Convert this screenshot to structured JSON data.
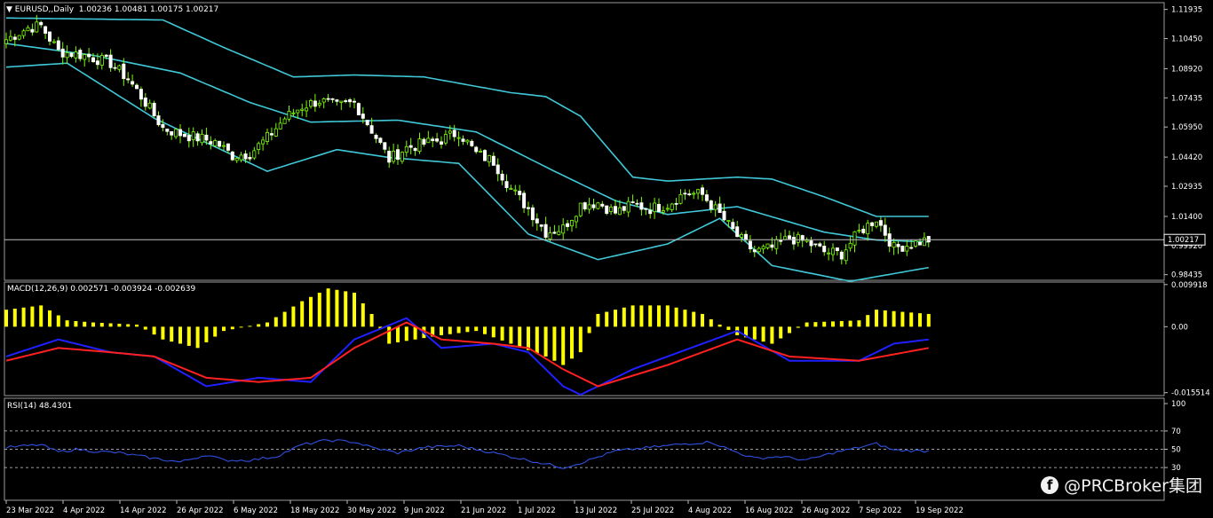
{
  "chart_data": [
    {
      "type": "candlestick",
      "title": "EURUSD,,Daily",
      "ohlc_readout": "1.00236 1.00481 1.00175 1.00217",
      "current_price_label": "1.00217",
      "current_price": 1.00217,
      "ylim": [
        0.9815,
        1.1228
      ],
      "y_ticks": [
        "1.11935",
        "1.10450",
        "1.08920",
        "1.07435",
        "1.05950",
        "1.04420",
        "1.02935",
        "1.01400",
        "0.99920",
        "0.98435"
      ],
      "x_tick_labels": [
        "23 Mar 2022",
        "4 Apr 2022",
        "14 Apr 2022",
        "26 Apr 2022",
        "6 May 2022",
        "18 May 2022",
        "30 May 2022",
        "9 Jun 2022",
        "21 Jun 2022",
        "1 Jul 2022",
        "13 Jul 2022",
        "25 Jul 2022",
        "4 Aug 2022",
        "16 Aug 2022",
        "26 Aug 2022",
        "7 Sep 2022",
        "19 Sep 2022"
      ],
      "close_trend": [
        [
          0,
          1.104
        ],
        [
          5,
          1.11
        ],
        [
          8,
          1.111
        ],
        [
          12,
          1.098
        ],
        [
          18,
          1.096
        ],
        [
          24,
          1.092
        ],
        [
          28,
          1.084
        ],
        [
          32,
          1.072
        ],
        [
          36,
          1.059
        ],
        [
          40,
          1.056
        ],
        [
          44,
          1.054
        ],
        [
          48,
          1.052
        ],
        [
          52,
          1.045
        ],
        [
          56,
          1.046
        ],
        [
          60,
          1.054
        ],
        [
          64,
          1.064
        ],
        [
          68,
          1.07
        ],
        [
          72,
          1.073
        ],
        [
          76,
          1.07
        ],
        [
          80,
          1.072
        ],
        [
          84,
          1.058
        ],
        [
          88,
          1.043
        ],
        [
          92,
          1.049
        ],
        [
          96,
          1.051
        ],
        [
          100,
          1.053
        ],
        [
          104,
          1.057
        ],
        [
          108,
          1.046
        ],
        [
          112,
          1.042
        ],
        [
          116,
          1.028
        ],
        [
          120,
          1.018
        ],
        [
          124,
          1.006
        ],
        [
          128,
          1.008
        ],
        [
          132,
          1.02
        ],
        [
          136,
          1.021
        ],
        [
          140,
          1.016
        ],
        [
          144,
          1.02
        ],
        [
          148,
          1.018
        ],
        [
          152,
          1.02
        ],
        [
          156,
          1.026
        ],
        [
          160,
          1.025
        ],
        [
          164,
          1.015
        ],
        [
          168,
          1.004
        ],
        [
          172,
          0.996
        ],
        [
          176,
          0.998
        ],
        [
          180,
          1.003
        ],
        [
          184,
          1.001
        ],
        [
          188,
          0.996
        ],
        [
          192,
          0.995
        ],
        [
          196,
          1.006
        ],
        [
          200,
          1.013
        ],
        [
          204,
          0.998
        ],
        [
          208,
          1.0
        ],
        [
          212,
          1.0022
        ]
      ],
      "bollinger_bands": {
        "upper": [
          [
            0,
            1.115
          ],
          [
            36,
            1.114
          ],
          [
            50,
            1.1
          ],
          [
            66,
            1.085
          ],
          [
            80,
            1.086
          ],
          [
            96,
            1.085
          ],
          [
            116,
            1.077
          ],
          [
            124,
            1.075
          ],
          [
            132,
            1.065
          ],
          [
            144,
            1.034
          ],
          [
            152,
            1.032
          ],
          [
            168,
            1.034
          ],
          [
            176,
            1.033
          ],
          [
            188,
            1.024
          ],
          [
            200,
            1.014
          ],
          [
            212,
            1.014
          ]
        ],
        "middle": [
          [
            0,
            1.102
          ],
          [
            20,
            1.096
          ],
          [
            40,
            1.087
          ],
          [
            56,
            1.072
          ],
          [
            70,
            1.062
          ],
          [
            90,
            1.063
          ],
          [
            108,
            1.057
          ],
          [
            126,
            1.037
          ],
          [
            140,
            1.022
          ],
          [
            152,
            1.015
          ],
          [
            168,
            1.019
          ],
          [
            188,
            1.006
          ],
          [
            200,
            1.002
          ],
          [
            212,
            1.001
          ]
        ],
        "lower": [
          [
            0,
            1.09
          ],
          [
            14,
            1.092
          ],
          [
            34,
            1.064
          ],
          [
            60,
            1.037
          ],
          [
            76,
            1.048
          ],
          [
            88,
            1.044
          ],
          [
            104,
            1.041
          ],
          [
            120,
            1.005
          ],
          [
            136,
            0.992
          ],
          [
            152,
            1.0
          ],
          [
            164,
            1.013
          ],
          [
            176,
            0.989
          ],
          [
            194,
            0.981
          ],
          [
            212,
            0.988
          ]
        ]
      },
      "indicator_colors": {
        "bull": "#7CFC00",
        "bollinger": "#40C8D8"
      }
    },
    {
      "type": "bar",
      "title": "MACD(12,26,9) 0.002571 -0.003924 -0.002639",
      "ylim": [
        -0.0162,
        0.0105
      ],
      "y_ticks": [
        "0.009918",
        "0.00",
        "-0.015514"
      ],
      "histogram_trend": [
        [
          0,
          0.004
        ],
        [
          8,
          0.005
        ],
        [
          14,
          0.0015
        ],
        [
          20,
          0.001
        ],
        [
          30,
          0.0005
        ],
        [
          36,
          -0.003
        ],
        [
          44,
          -0.005
        ],
        [
          50,
          -0.001
        ],
        [
          60,
          0.001
        ],
        [
          68,
          0.006
        ],
        [
          74,
          0.009
        ],
        [
          80,
          0.008
        ],
        [
          84,
          0.003
        ],
        [
          88,
          -0.004
        ],
        [
          94,
          -0.003
        ],
        [
          100,
          -0.002
        ],
        [
          108,
          -0.001
        ],
        [
          116,
          -0.004
        ],
        [
          124,
          -0.007
        ],
        [
          128,
          -0.009
        ],
        [
          132,
          -0.006
        ],
        [
          136,
          0.003
        ],
        [
          144,
          0.005
        ],
        [
          152,
          0.005
        ],
        [
          160,
          0.003
        ],
        [
          168,
          -0.002
        ],
        [
          176,
          -0.004
        ],
        [
          184,
          0.001
        ],
        [
          196,
          0.0015
        ],
        [
          200,
          0.004
        ],
        [
          212,
          0.003
        ]
      ],
      "macd_line": [
        [
          0,
          -0.007
        ],
        [
          12,
          -0.003
        ],
        [
          24,
          -0.006
        ],
        [
          34,
          -0.007
        ],
        [
          46,
          -0.014
        ],
        [
          58,
          -0.012
        ],
        [
          70,
          -0.013
        ],
        [
          80,
          -0.003
        ],
        [
          92,
          0.002
        ],
        [
          100,
          -0.005
        ],
        [
          112,
          -0.004
        ],
        [
          120,
          -0.006
        ],
        [
          128,
          -0.014
        ],
        [
          132,
          -0.016
        ],
        [
          144,
          -0.01
        ],
        [
          152,
          -0.007
        ],
        [
          168,
          -0.001
        ],
        [
          180,
          -0.008
        ],
        [
          196,
          -0.008
        ],
        [
          204,
          -0.004
        ],
        [
          212,
          -0.003
        ]
      ],
      "signal_line": [
        [
          0,
          -0.008
        ],
        [
          12,
          -0.005
        ],
        [
          24,
          -0.006
        ],
        [
          34,
          -0.007
        ],
        [
          46,
          -0.012
        ],
        [
          58,
          -0.013
        ],
        [
          70,
          -0.012
        ],
        [
          80,
          -0.005
        ],
        [
          92,
          0.001
        ],
        [
          100,
          -0.003
        ],
        [
          112,
          -0.004
        ],
        [
          120,
          -0.005
        ],
        [
          128,
          -0.01
        ],
        [
          136,
          -0.014
        ],
        [
          152,
          -0.009
        ],
        [
          168,
          -0.003
        ],
        [
          180,
          -0.007
        ],
        [
          196,
          -0.008
        ],
        [
          212,
          -0.005
        ]
      ],
      "colors": {
        "histogram": "#FFFF00",
        "macd": "#2020FF",
        "signal": "#FF2020"
      }
    },
    {
      "type": "line",
      "title": "RSI(14) 48.4301",
      "ylim": [
        0,
        100
      ],
      "y_ticks": [
        "100",
        "70",
        "50",
        "30",
        "0"
      ],
      "levels": [
        30,
        50,
        70
      ],
      "rsi_trend": [
        [
          0,
          52
        ],
        [
          8,
          55
        ],
        [
          12,
          47
        ],
        [
          16,
          50
        ],
        [
          20,
          48
        ],
        [
          26,
          46
        ],
        [
          34,
          40
        ],
        [
          40,
          36
        ],
        [
          46,
          44
        ],
        [
          50,
          38
        ],
        [
          56,
          38
        ],
        [
          62,
          42
        ],
        [
          68,
          55
        ],
        [
          74,
          60
        ],
        [
          80,
          58
        ],
        [
          84,
          52
        ],
        [
          90,
          46
        ],
        [
          96,
          52
        ],
        [
          104,
          54
        ],
        [
          110,
          48
        ],
        [
          116,
          42
        ],
        [
          122,
          36
        ],
        [
          128,
          30
        ],
        [
          132,
          35
        ],
        [
          140,
          48
        ],
        [
          148,
          52
        ],
        [
          156,
          56
        ],
        [
          162,
          58
        ],
        [
          166,
          50
        ],
        [
          172,
          40
        ],
        [
          178,
          42
        ],
        [
          184,
          38
        ],
        [
          190,
          46
        ],
        [
          196,
          52
        ],
        [
          200,
          56
        ],
        [
          204,
          49
        ],
        [
          212,
          48
        ]
      ],
      "color": "#3050E0"
    }
  ],
  "watermark": {
    "icon": "facebook-icon",
    "icon_glyph": "f",
    "text": "@PRCBroker集团"
  }
}
